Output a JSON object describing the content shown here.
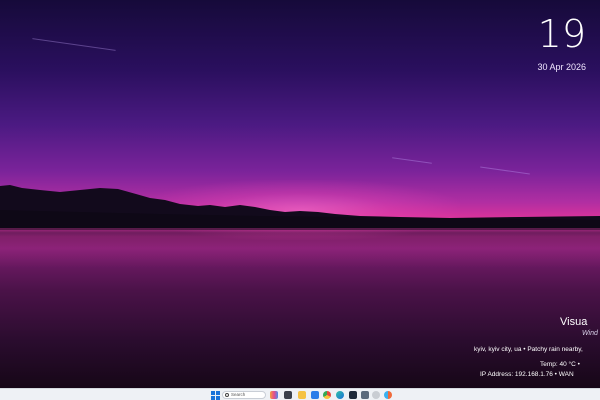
{
  "clock": {
    "time": "19",
    "date": "30 Apr 2026"
  },
  "info": {
    "title": "Visua",
    "subtitle": "Wind",
    "weather": "kyiv, kyiv city, ua • Patchy rain nearby,",
    "temp": "Temp: 40 °C •",
    "ip": "IP Address: 192.168.1.76 • WAN"
  },
  "taskbar": {
    "search_placeholder": "Search",
    "icons": [
      "widgets-icon",
      "task-view-icon",
      "file-explorer-icon",
      "store-icon",
      "chrome-icon",
      "edge-icon",
      "terminal-icon",
      "settings-icon",
      "app-icon",
      "photos-icon"
    ]
  },
  "colors": {
    "sky_top": "#160a3a",
    "glow": "#d7329c",
    "taskbar": "#eef1f5",
    "accent": "#1a73d9"
  }
}
